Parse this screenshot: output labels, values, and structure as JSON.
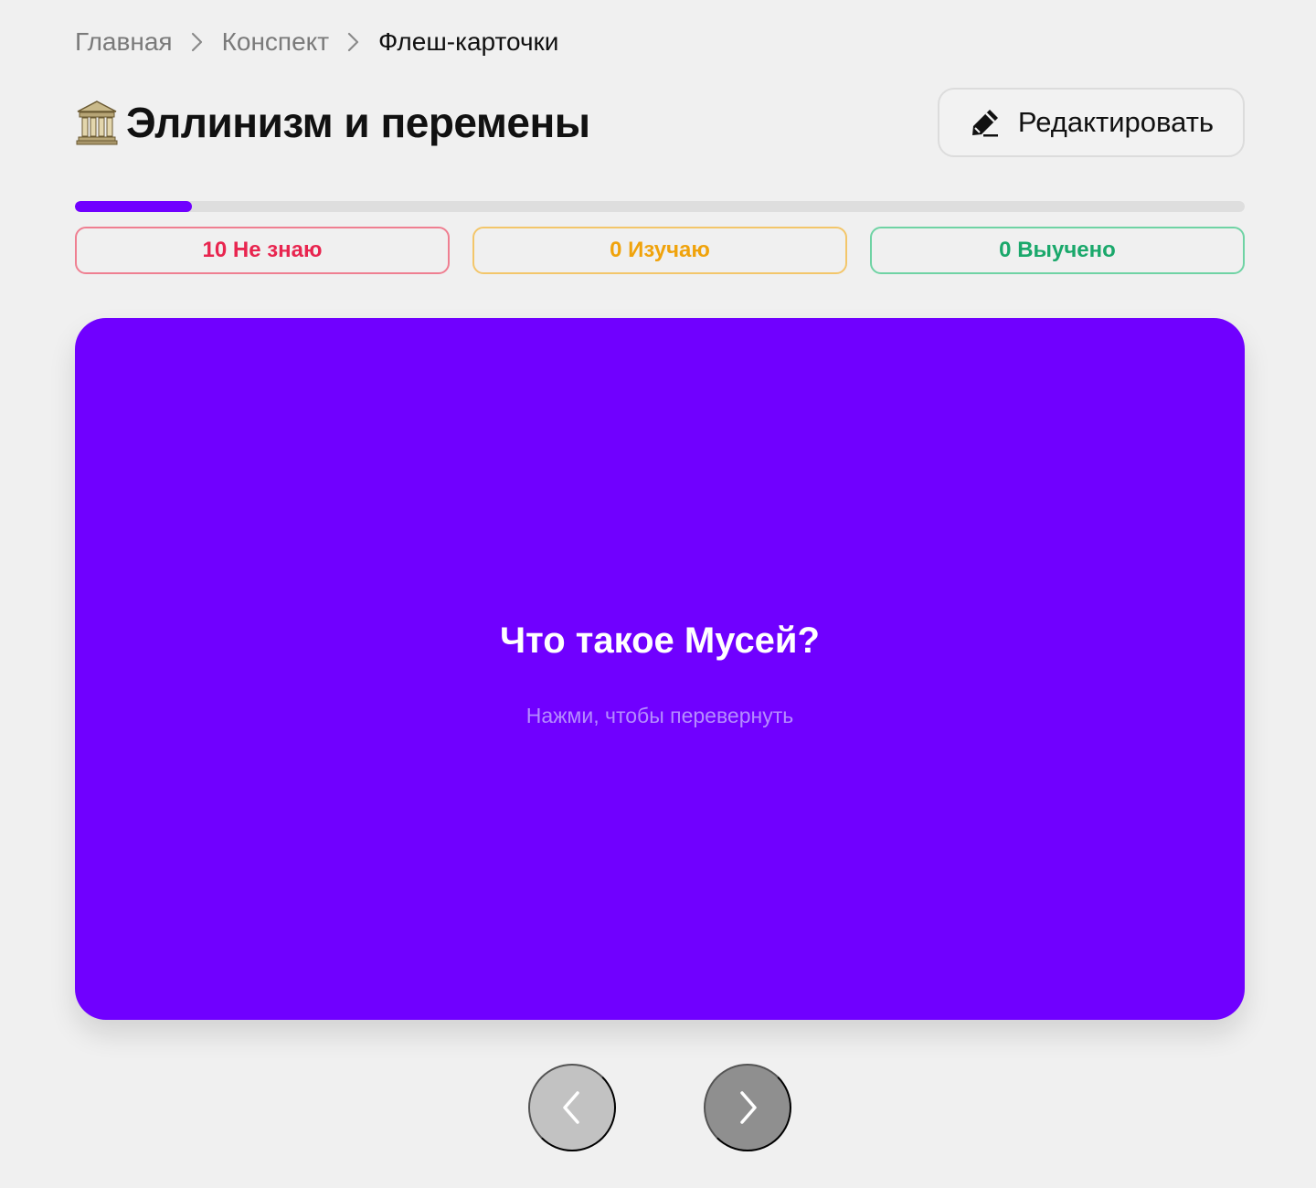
{
  "breadcrumb": {
    "items": [
      {
        "label": "Главная"
      },
      {
        "label": "Конспект"
      },
      {
        "label": "Флеш-карточки"
      }
    ]
  },
  "header": {
    "emoji_icon": "classical-building-icon",
    "title": "Эллинизм и перемены",
    "edit_label": "Редактировать",
    "edit_icon": "pencil-icon"
  },
  "progress": {
    "fraction": 0.1,
    "color": "#7000ff"
  },
  "stats": {
    "unknown": {
      "label": "10 Не знаю",
      "color": "#e8254f",
      "border": "#ef7f91"
    },
    "learning": {
      "label": "0 Изучаю",
      "color": "#f0a30c",
      "border": "#f3c66a"
    },
    "learned": {
      "label": "0 Выучено",
      "color": "#1aa86b",
      "border": "#6fd3a4"
    }
  },
  "card": {
    "question": "Что такое Мусей?",
    "hint": "Нажми, чтобы перевернуть",
    "color": "#7000ff"
  },
  "navigation": {
    "prev_icon": "chevron-left-icon",
    "next_icon": "chevron-right-icon"
  }
}
